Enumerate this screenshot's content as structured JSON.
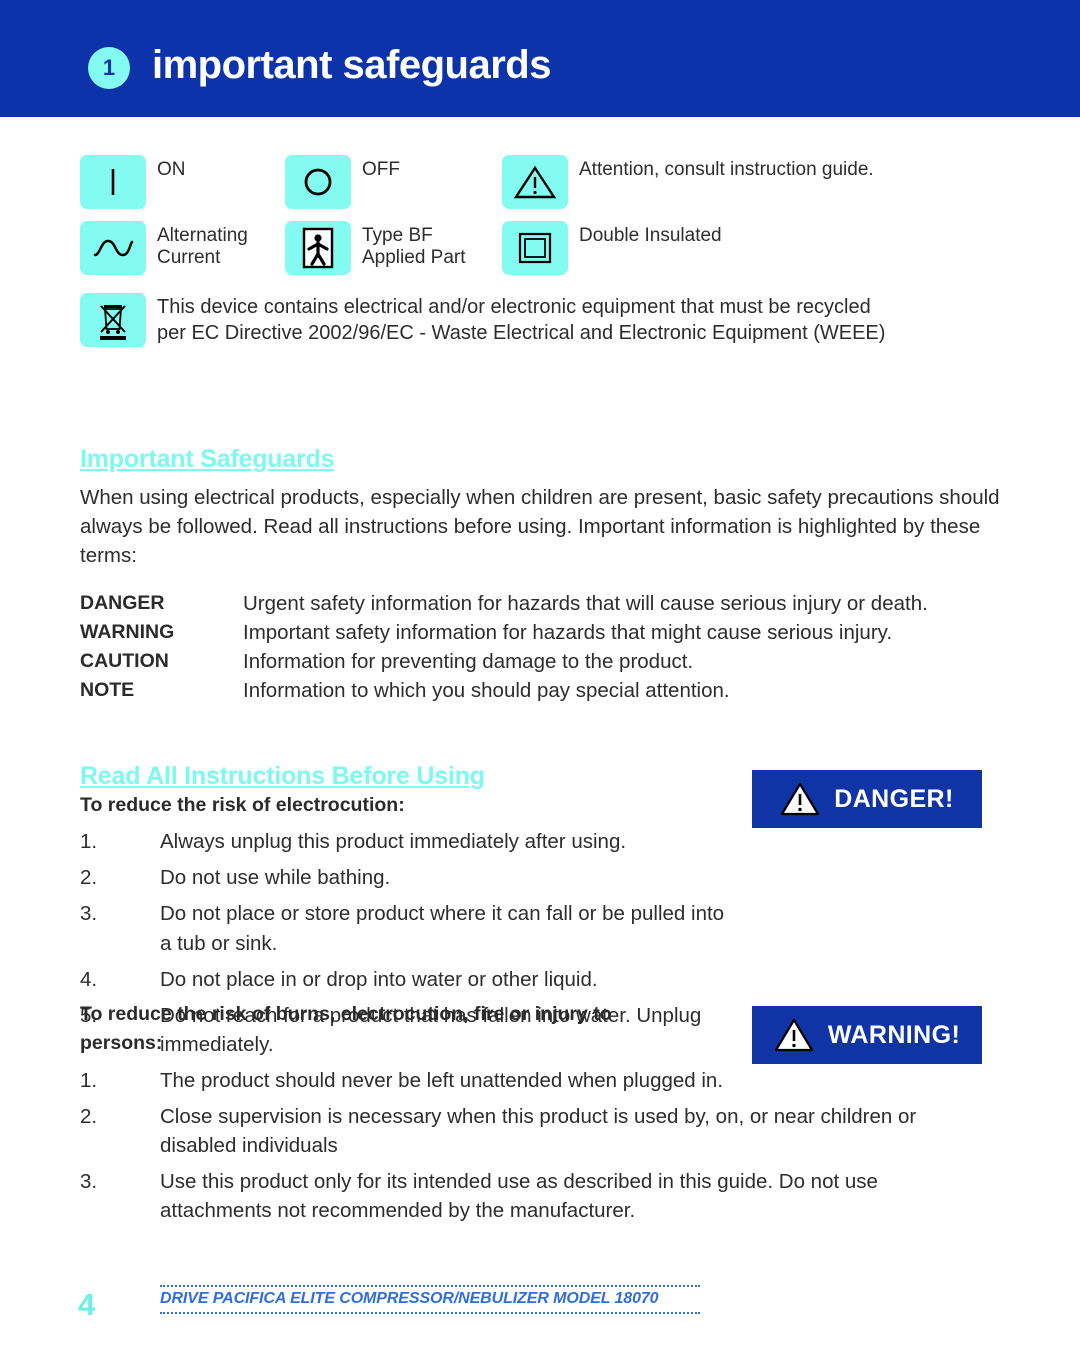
{
  "header": {
    "chapter_number": "1",
    "title": "important safeguards",
    "bar_color": "#0d33ab",
    "badge_color": "#83fbf0"
  },
  "legend": {
    "rows": [
      [
        {
          "icon": "power-on-line-icon",
          "label": "ON"
        },
        {
          "icon": "power-off-circle-icon",
          "label": "OFF"
        },
        {
          "icon": "attention-triangle-icon",
          "label": "Attention, consult instruction guide."
        }
      ],
      [
        {
          "icon": "alternating-current-sine-icon",
          "label": "Alternating\nCurrent"
        },
        {
          "icon": "type-bf-applied-part-icon",
          "label": "Type BF\nApplied Part"
        },
        {
          "icon": "double-insulated-square-icon",
          "label": "Double Insulated"
        }
      ]
    ],
    "weee": {
      "icon": "crossed-out-wheeled-bin-icon",
      "line1": "This device contains electrical and/or electronic equipment that must be recycled",
      "line2": "per EC Directive 2002/96/EC - Waste Electrical and Electronic Equipment (WEEE)"
    },
    "box_color": "#83fbf0"
  },
  "safeguards": {
    "heading": "Important Safeguards ",
    "heading_color": "#7df9ef",
    "paragraph": "When using electrical products, especially when children are present, basic safety precautions should always be followed. Read all instructions before using. Important information is highlighted by these terms:"
  },
  "terms": [
    {
      "name": "DANGER",
      "description": "Urgent safety information for hazards that will cause serious injury or death."
    },
    {
      "name": "WARNING",
      "description": "Important safety information for hazards that might cause serious injury."
    },
    {
      "name": "CAUTION",
      "description": "Information for preventing damage to the product."
    },
    {
      "name": "NOTE",
      "description": "Information to which you should pay special attention."
    }
  ],
  "instructions": {
    "heading": "Read All Instructions Before Using",
    "electrocution": {
      "subhead": "To reduce the risk of electrocution:",
      "items": [
        {
          "num": "1.",
          "text": "Always unplug this product immediately after using."
        },
        {
          "num": "2.",
          "text": "Do not use while bathing."
        },
        {
          "num": "3.",
          "text": "Do not place or store product where it can fall or be pulled into a tub or sink."
        },
        {
          "num": "4.",
          "text": "Do not place in or drop into water or other liquid."
        },
        {
          "num": "5.",
          "text": "Do not reach for a product that has fallen into water. Unplug immediately."
        }
      ]
    },
    "burns": {
      "subhead": "To reduce the risk of burns, electrocution, fire or injury to persons:",
      "items": [
        {
          "num": "1.",
          "text": "The product should never be left unattended when plugged in."
        },
        {
          "num": "2.",
          "text": "Close supervision is necessary when this product is used by, on, or near children or disabled individuals"
        },
        {
          "num": "3.",
          "text": "Use this product only for its intended use as described in this guide. Do not use attachments not recommended by the manufacturer."
        }
      ]
    }
  },
  "badges": {
    "danger": {
      "label": "DANGER!",
      "icon": "warning-triangle-icon",
      "background": "#1034a6"
    },
    "warning": {
      "label": "WARNING!",
      "icon": "warning-triangle-icon",
      "background": "#1034a6"
    }
  },
  "footer": {
    "page_number": "4",
    "text": "DRIVE PACIFICA ELITE COMPRESSOR/NEBULIZER   MODEL 18070",
    "page_number_color": "#6ef0e4",
    "text_color": "#2f6ee0"
  }
}
